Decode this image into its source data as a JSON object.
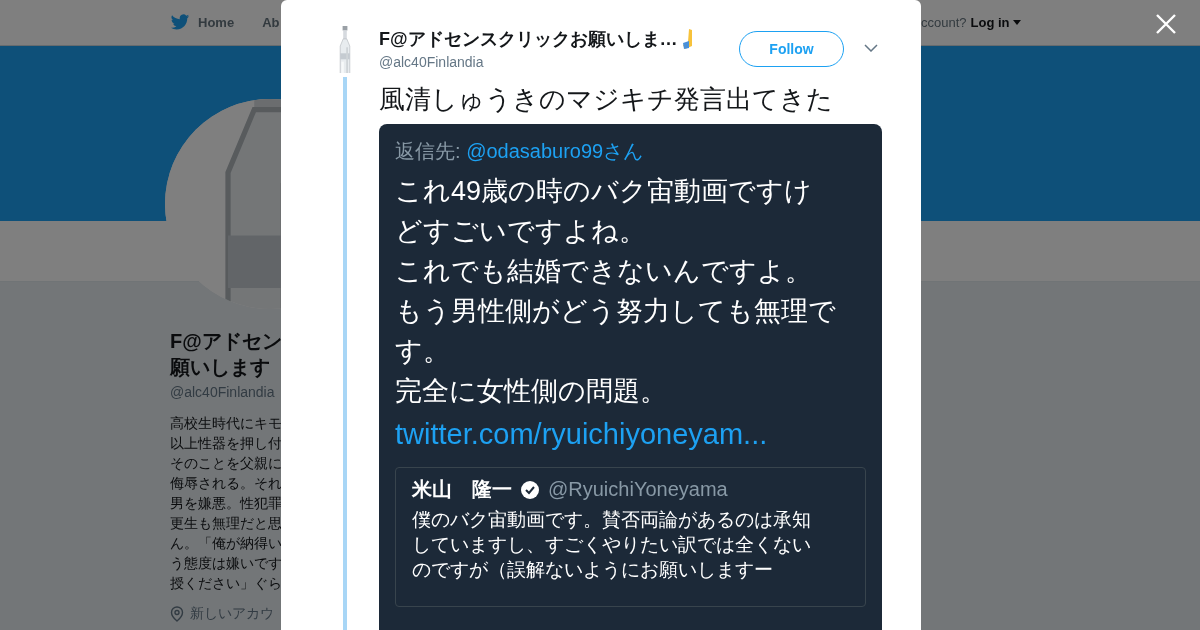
{
  "top_nav": {
    "items": [
      {
        "label": "Home"
      },
      {
        "label": "Ab"
      }
    ],
    "account_prompt": "ccount?",
    "login": "Log in"
  },
  "profile": {
    "name_lines": [
      "F@アドセン",
      "願いします"
    ],
    "handle": "@alc40Finlandia",
    "bio_lines": [
      "高校生時代にキモ",
      "以上性器を押し付",
      "そのことを父親に",
      "侮辱される。それ",
      "男を嫌悪。性犯罪",
      "更生も無理だと思",
      "ん。「俺が納得い",
      "う態度は嫌いです",
      "授ください」ぐら"
    ],
    "location": "新しいアカウ"
  },
  "tweet": {
    "author": "F@アドセンスクリックお願いしま…",
    "handle": "@alc40Finlandia",
    "follow": "Follow",
    "text": "風清しゅうきのマジキチ発言出てきた",
    "image": {
      "reply_label": "返信先:",
      "reply_to": "@odasaburo99さん",
      "body_lines": [
        "これ49歳の時のバク宙動画ですけ",
        "どすごいですよね。",
        "これでも結婚できないんですよ。",
        "もう男性側がどう努力しても無理で",
        "す。",
        "完全に女性側の問題。"
      ],
      "link": "twitter.com/ryuichiyoneyam...",
      "quote": {
        "name": "米山　隆一",
        "verified": true,
        "handle": "@RyuichiYoneyama",
        "text_lines": [
          "僕のバク宙動画です。賛否両論があるのは承知",
          "していますし、すごくやりたい訳では全くない",
          "のですが（誤解ないようにお願いしますー"
        ]
      }
    }
  }
}
